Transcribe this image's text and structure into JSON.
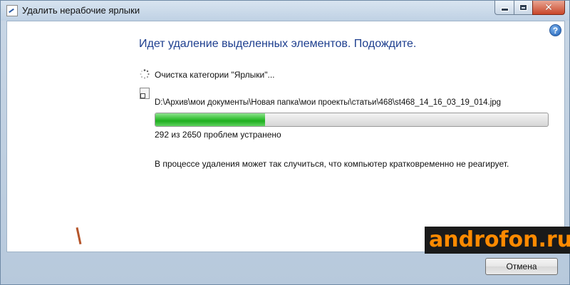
{
  "window": {
    "title": "Удалить нерабочие ярлыки"
  },
  "icons": {
    "title": "shortcut-repair-icon",
    "help": "help-icon",
    "spinner": "busy-spinner-icon",
    "shortcut": "shortcut-file-icon"
  },
  "controls": {
    "minimize": "–",
    "maximize": "□",
    "close": "✕",
    "help": "?"
  },
  "main": {
    "heading": "Идет удаление выделенных элементов. Подождите.",
    "status": "Очистка категории \"Ярлыки\"...",
    "current_path": "D:\\Архив\\мои документы\\Новая папка\\мои проекты\\статьи\\468\\st468_14_16_03_19_014.jpg",
    "progress_fraction": 0.28,
    "count_text": "292 из 2650 проблем устранено",
    "note": "В процессе удаления может так случиться, что компьютер кратковременно не реагирует."
  },
  "footer": {
    "cancel_label": "Отмена"
  },
  "watermark": "androfon.ru",
  "colors": {
    "heading": "#1e3f8f",
    "progress": "#1fae1f",
    "watermark_text": "#ff8a00"
  }
}
